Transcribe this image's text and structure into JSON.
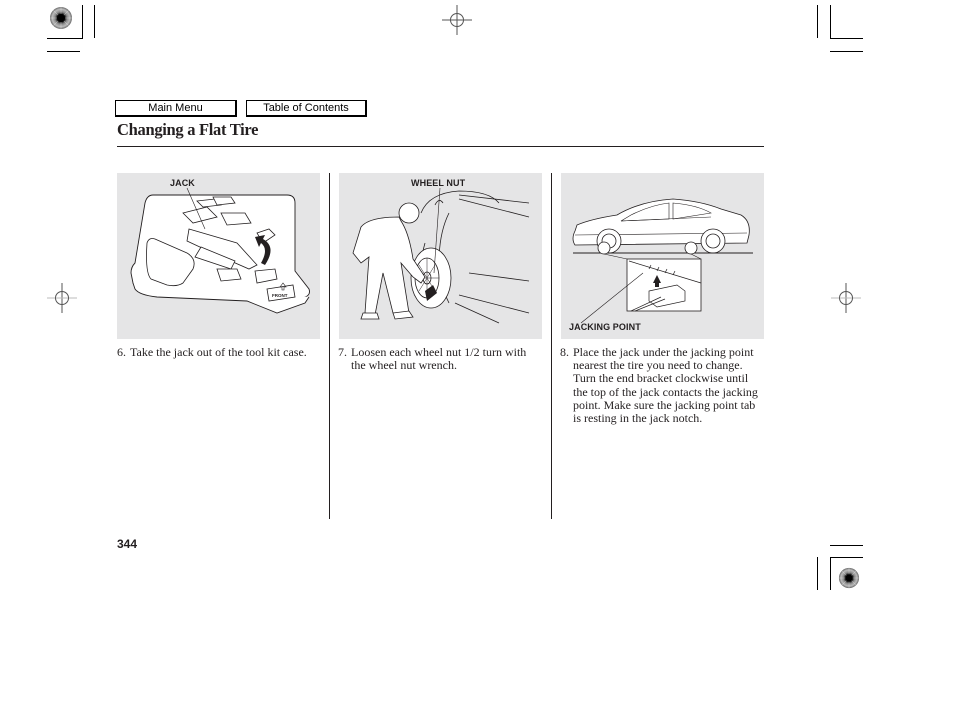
{
  "nav": {
    "main_menu": "Main Menu",
    "table_of_contents": "Table of Contents"
  },
  "page": {
    "title": "Changing a Flat Tire",
    "page_number": "344"
  },
  "figures": [
    {
      "callout": "JACK",
      "inset_label": "FRONT"
    },
    {
      "callout": "WHEEL NUT"
    },
    {
      "callout": "JACKING POINT"
    }
  ],
  "steps": [
    {
      "number": "6.",
      "text": "Take the jack out of the tool kit case."
    },
    {
      "number": "7.",
      "text": "Loosen each wheel nut 1/2 turn with the wheel nut wrench."
    },
    {
      "number": "8.",
      "text": "Place the jack under the jacking point nearest the tire you need to change. Turn the end bracket clockwise until the top of the jack contacts the jacking point. Make sure the jacking point tab is resting in the jack notch."
    }
  ],
  "icons": {
    "registration_target": "crosshair-circle",
    "color_target": "sunburst-disc"
  },
  "colors": {
    "ink": "#231f20",
    "figure_background": "#e5e5e6"
  }
}
